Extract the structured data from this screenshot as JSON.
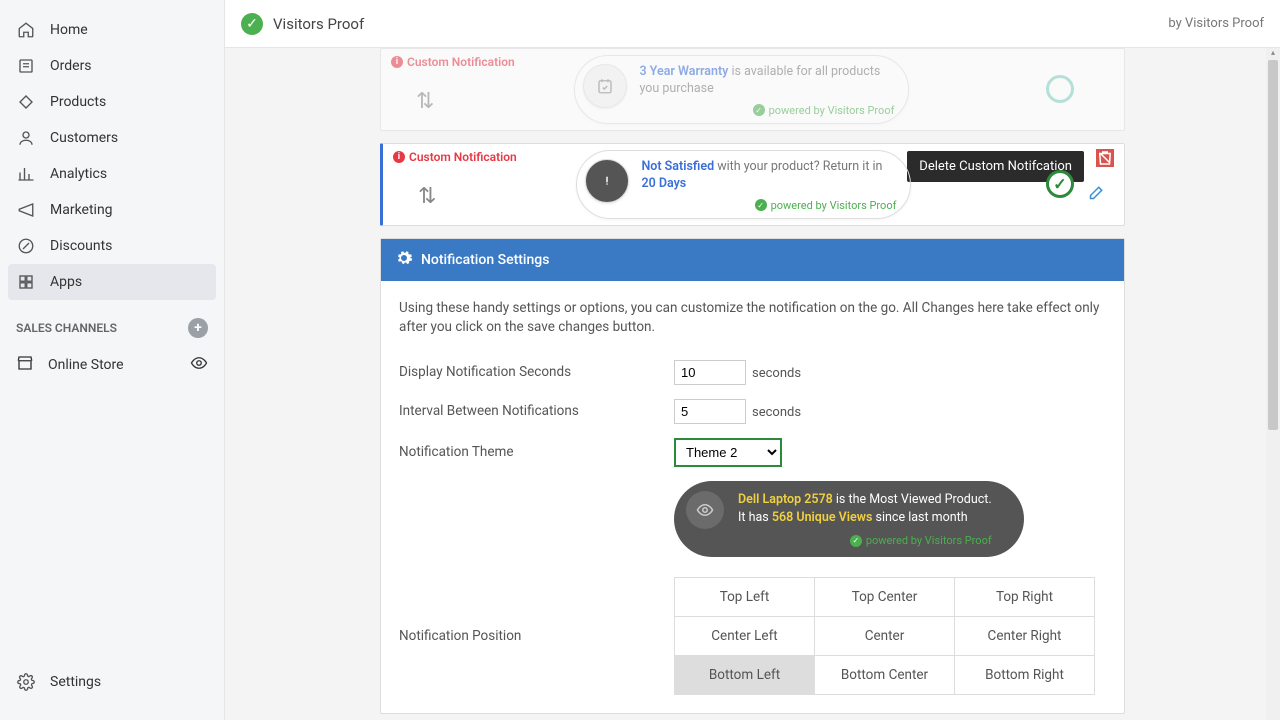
{
  "header": {
    "title": "Visitors Proof",
    "by": "by Visitors Proof"
  },
  "sidebar": {
    "items": [
      {
        "label": "Home"
      },
      {
        "label": "Orders"
      },
      {
        "label": "Products"
      },
      {
        "label": "Customers"
      },
      {
        "label": "Analytics"
      },
      {
        "label": "Marketing"
      },
      {
        "label": "Discounts"
      },
      {
        "label": "Apps"
      }
    ],
    "section": "SALES CHANNELS",
    "store": "Online Store",
    "settings": "Settings"
  },
  "cards": {
    "label": "Custom Notification",
    "powered": "powered by Visitors Proof",
    "c1": {
      "hl": "3 Year Warranty",
      "rest": " is available for all products you purchase"
    },
    "c2": {
      "hl": "Not Satisfied",
      "rest1": " with your product? Return it in ",
      "hl2": "20 Days"
    },
    "tooltip": "Delete Custom Notifcation"
  },
  "settings": {
    "title": "Notification Settings",
    "desc": "Using these handy settings or options, you can customize the notification on the go. All Changes here take effect only after you click on the save changes button.",
    "rows": {
      "display": {
        "label": "Display Notification Seconds",
        "value": "10",
        "suffix": "seconds"
      },
      "interval": {
        "label": "Interval Between Notifications",
        "value": "5",
        "suffix": "seconds"
      },
      "theme": {
        "label": "Notification Theme",
        "value": "Theme 2"
      },
      "position": {
        "label": "Notification Position"
      }
    },
    "theme_box": {
      "t1a": "Dell Laptop 2578",
      "t1b": " is the Most Viewed Product.",
      "t2a": "It has ",
      "t2b": "568 Unique Views",
      "t2c": " since last month"
    },
    "positions": [
      "Top Left",
      "Top Center",
      "Top Right",
      "Center Left",
      "Center",
      "Center Right",
      "Bottom Left",
      "Bottom Center",
      "Bottom Right"
    ],
    "selected_position": "Bottom Left"
  }
}
